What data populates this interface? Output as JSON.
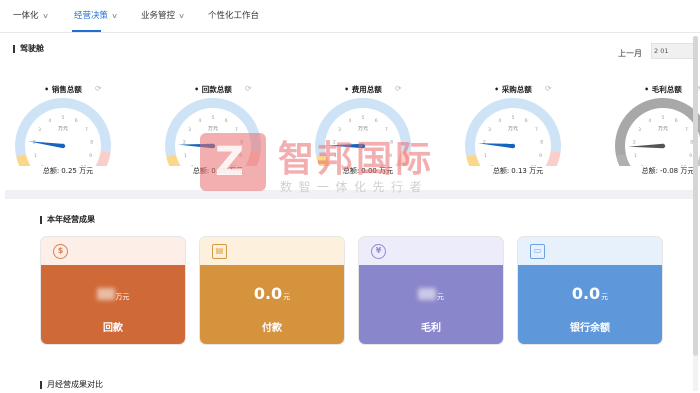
{
  "nav": {
    "tabs": [
      {
        "label": "一体化",
        "chevron": true,
        "active": false
      },
      {
        "label": "经营决策",
        "chevron": true,
        "active": true
      },
      {
        "label": "业务管控",
        "chevron": true,
        "active": false
      },
      {
        "label": "个性化工作台",
        "chevron": false,
        "active": false
      }
    ]
  },
  "cockpit": {
    "title": "驾驶舱",
    "period_label": "上一月",
    "period_value": "2    01"
  },
  "gauges": [
    {
      "title": "销售总额",
      "unit": "万元",
      "total_label": "总额:",
      "total_value": "0.25 万元",
      "value": 0.25,
      "max": 10,
      "ticks": [
        "0",
        "1",
        "2",
        "3",
        "4",
        "5",
        "6",
        "7",
        "8",
        "9",
        "10"
      ],
      "color": "#1565c0"
    },
    {
      "title": "回款总额",
      "unit": "万元",
      "total_label": "总额:",
      "total_value": "0.05 万元",
      "value": 0.05,
      "max": 10,
      "ticks": [
        "0",
        "1",
        "2",
        "3",
        "4",
        "5",
        "6",
        "7",
        "8",
        "9",
        "10"
      ],
      "color": "#1565c0"
    },
    {
      "title": "费用总额",
      "unit": "万元",
      "total_label": "总额:",
      "total_value": "0.00 万元",
      "value": 0,
      "max": 10,
      "ticks": [
        "0",
        "1",
        "2",
        "3",
        "4",
        "5",
        "6",
        "7",
        "8",
        "9",
        "10"
      ],
      "color": "#1565c0"
    },
    {
      "title": "采购总额",
      "unit": "万元",
      "total_label": "总额:",
      "total_value": "0.13 万元",
      "value": 0.13,
      "max": 10,
      "ticks": [
        "0",
        "1",
        "2",
        "3",
        "4",
        "5",
        "6",
        "7",
        "8",
        "9",
        "10"
      ],
      "color": "#1565c0"
    },
    {
      "title": "毛利总额",
      "unit": "万元",
      "total_label": "总额:",
      "total_value": "-0.08 万元",
      "value": -0.08,
      "max": 10,
      "ticks": [
        "0",
        "1",
        "2",
        "3",
        "4",
        "5",
        "6",
        "7",
        "8",
        "9",
        "10"
      ],
      "color": "#555555"
    }
  ],
  "results": {
    "title": "本年经营成果",
    "cards": [
      {
        "label": "回款",
        "value": "",
        "unit": "万元",
        "icon": "dollar-icon",
        "icon_glyph": "$",
        "top": "#fdeee8",
        "body": "#cf6a38",
        "accent": "#d9804f"
      },
      {
        "label": "付款",
        "value": "0.0",
        "unit": "元",
        "icon": "document-icon",
        "icon_glyph": "▤",
        "top": "#fdf1de",
        "body": "#d4933c",
        "accent": "#d59a3f"
      },
      {
        "label": "毛利",
        "value": "",
        "unit": "元",
        "icon": "yen-icon",
        "icon_glyph": "¥",
        "top": "#ececfb",
        "body": "#8a86cb",
        "accent": "#8f8bd3"
      },
      {
        "label": "银行余额",
        "value": "0.0",
        "unit": "元",
        "icon": "wallet-icon",
        "icon_glyph": "▭",
        "top": "#e7f1fc",
        "body": "#5f97db",
        "accent": "#6ea3e3"
      }
    ]
  },
  "monthly": {
    "title": "月经营成果对比"
  },
  "watermark": {
    "logo": "Z",
    "title": "智邦国际",
    "subtitle": "数智一体化先行者"
  }
}
